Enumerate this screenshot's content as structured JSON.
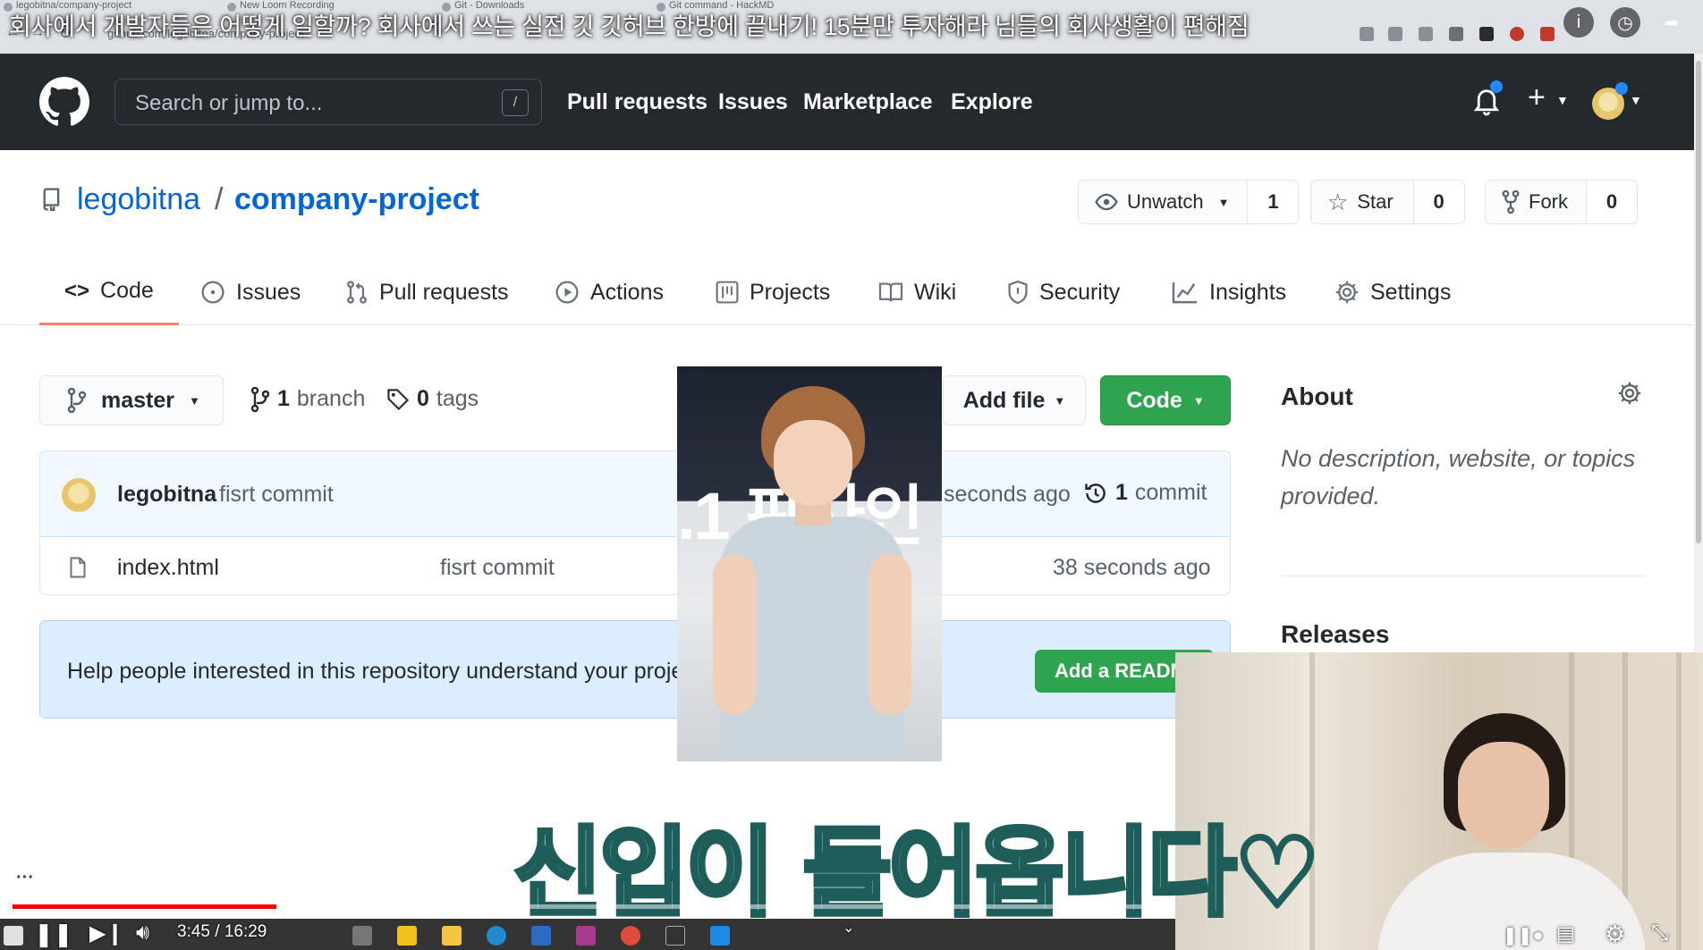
{
  "video": {
    "title": "회사에서 개발자들은 어떻게 일할까? 회사에서 쓰는 실전 깃 깃허브 한방에 끝내기! 15분만 투자해라 님들의 회사생활이 편해짐",
    "time": "3:45 / 16:29",
    "progress": 0.227,
    "caption": "신입이 들어옵니다♡",
    "photo_sign": ".1 판사인"
  },
  "browser": {
    "tabs": [
      "legobitna/company-project",
      "New Loom Recording",
      "Git - Downloads",
      "Git command - HackMD"
    ],
    "url": "github.com/legobitna/company-project"
  },
  "header": {
    "search_placeholder": "Search or jump to...",
    "search_key": "/",
    "nav": [
      "Pull requests",
      "Issues",
      "Marketplace",
      "Explore"
    ]
  },
  "repo": {
    "owner": "legobitna",
    "separator": "/",
    "name": "company-project",
    "watch": {
      "label": "Unwatch",
      "count": "1"
    },
    "star": {
      "label": "Star",
      "count": "0"
    },
    "fork": {
      "label": "Fork",
      "count": "0"
    }
  },
  "tabs": {
    "code": "Code",
    "issues": "Issues",
    "pulls": "Pull requests",
    "actions": "Actions",
    "projects": "Projects",
    "wiki": "Wiki",
    "security": "Security",
    "insights": "Insights",
    "settings": "Settings"
  },
  "toolbar": {
    "branch": "master",
    "branch_count": "1",
    "branch_word": "branch",
    "tag_count": "0",
    "tag_word": "tags",
    "add_file": "Add file",
    "code": "Code"
  },
  "commit": {
    "author": "legobitna",
    "message": "fisrt commit",
    "time": "seconds ago",
    "count": "1",
    "count_word": "commit"
  },
  "files": [
    {
      "name": "index.html",
      "message": "fisrt commit",
      "time": "38 seconds ago"
    }
  ],
  "readme": {
    "text": "Help people interested in this repository understand your proje",
    "button": "Add a READM"
  },
  "about": {
    "title": "About",
    "description": "No description, website, or topics provided.",
    "releases": "Releases"
  },
  "colors": {
    "header_bg": "#24292e",
    "link": "#0366d6",
    "green": "#2ea44f",
    "tab_underline": "#f9826c",
    "progress_red": "#ff0000"
  }
}
